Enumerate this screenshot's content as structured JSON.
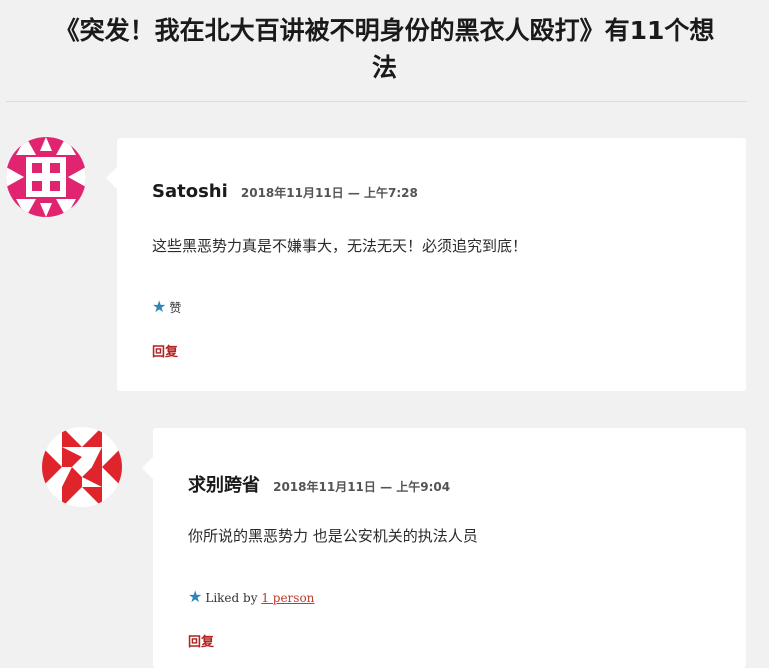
{
  "page": {
    "title_line1": "《突发！我在北大百讲被不明身份的黑衣人殴打》有11个想",
    "title_line2": "法"
  },
  "comments": [
    {
      "author": "Satoshi",
      "date": "2018年11月11日 — 上午7:28",
      "text": "这些黑恶势力真是不嫌事大，无法无天！必须追究到底！",
      "like_label": "赞",
      "reply_label": "回复"
    },
    {
      "author": "求别跨省",
      "date": "2018年11月11日 — 上午9:04",
      "text": "你所说的黑恶势力 也是公安机关的执法人员",
      "liked_by_prefix": "Liked by",
      "liked_by_link": "1 person",
      "reply_label": "回复"
    }
  ],
  "colors": {
    "avatar1": "#e0246f",
    "avatar2": "#e0242c",
    "star": "#2e85b8",
    "reply": "#b22222"
  }
}
